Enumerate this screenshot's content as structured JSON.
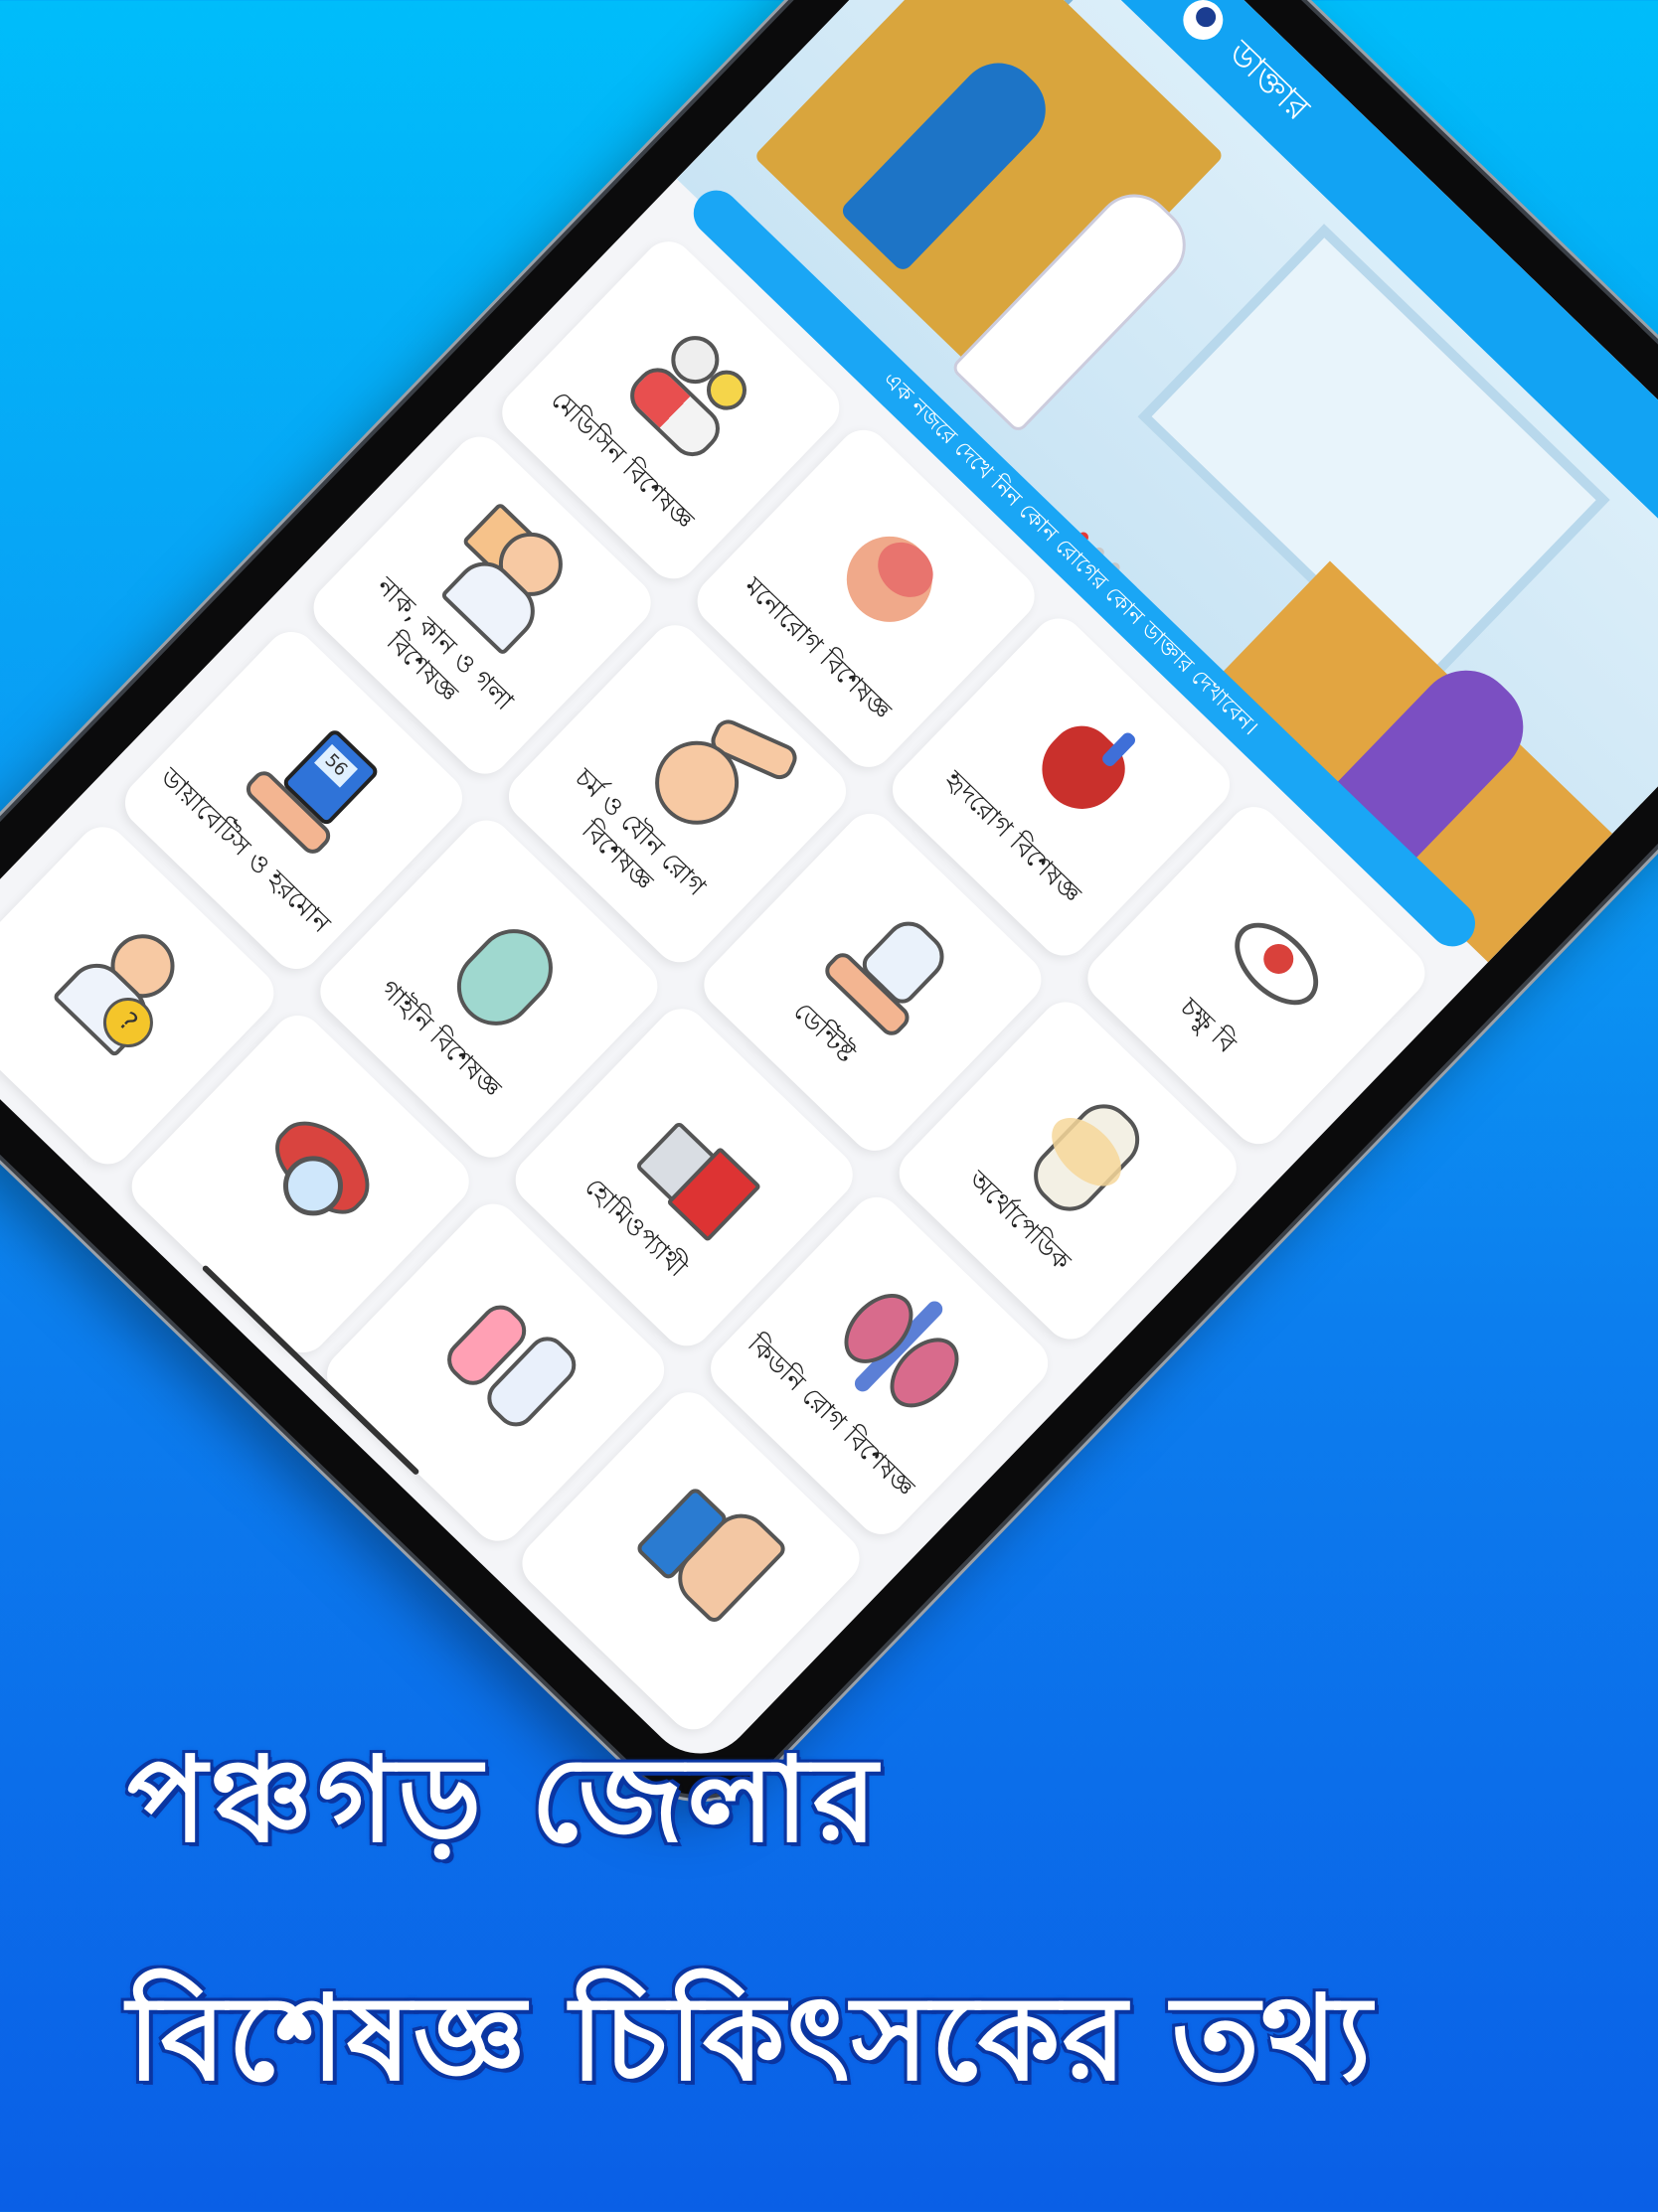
{
  "app": {
    "title": "ডাক্তার"
  },
  "marquee": {
    "text": "এক নজরে দেখে নিন কোন রোগের কোন ডাক্তার দেখাবেন।"
  },
  "categories": [
    {
      "label": "মেডিসিন বিশেষজ্ঞ",
      "icon": "pills-icon"
    },
    {
      "label": "মনোরোগ বিশেষজ্ঞ",
      "icon": "brain-icon"
    },
    {
      "label": "হৃদরোগ বিশেষজ্ঞ",
      "icon": "heart-icon"
    },
    {
      "label": "চক্ষু বি",
      "icon": "eye-icon"
    },
    {
      "label": "নাক, কান ও গলা বিশেষজ্ঞ",
      "icon": "ent-doctor-icon"
    },
    {
      "label": "চর্ম ও যৌন রোগ বিশেষজ্ঞ",
      "icon": "skin-icon"
    },
    {
      "label": "ডেন্টিষ্ট",
      "icon": "tooth-icon"
    },
    {
      "label": "অর্থোপেডিক",
      "icon": "bone-joint-icon"
    },
    {
      "label": "ডায়াবেটিস ও হরমোন",
      "icon": "glucose-meter-icon"
    },
    {
      "label": "গাইনি বিশেষজ্ঞ",
      "icon": "pregnancy-icon"
    },
    {
      "label": "হোমিওপ্যাথী",
      "icon": "homeopathy-icon"
    },
    {
      "label": "কিডনি রোগ বিশেষজ্ঞ",
      "icon": "kidney-icon"
    },
    {
      "label": "",
      "icon": "doctor-question-icon"
    },
    {
      "label": "",
      "icon": "liver-icon"
    },
    {
      "label": "",
      "icon": "pediatric-icon"
    },
    {
      "label": "",
      "icon": "asthma-inhaler-icon"
    }
  ],
  "headline": {
    "line1": "পঞ্চগড় জেলার",
    "line2": "বিশেষজ্ঞ চিকিৎসকের তথ্য"
  },
  "colors": {
    "background_top": "#00bdfa",
    "background_bottom": "#0a5fe6",
    "app_bar": "#12a3f3",
    "headline_text": "#ffffff",
    "headline_outline": "#0b35a0"
  }
}
